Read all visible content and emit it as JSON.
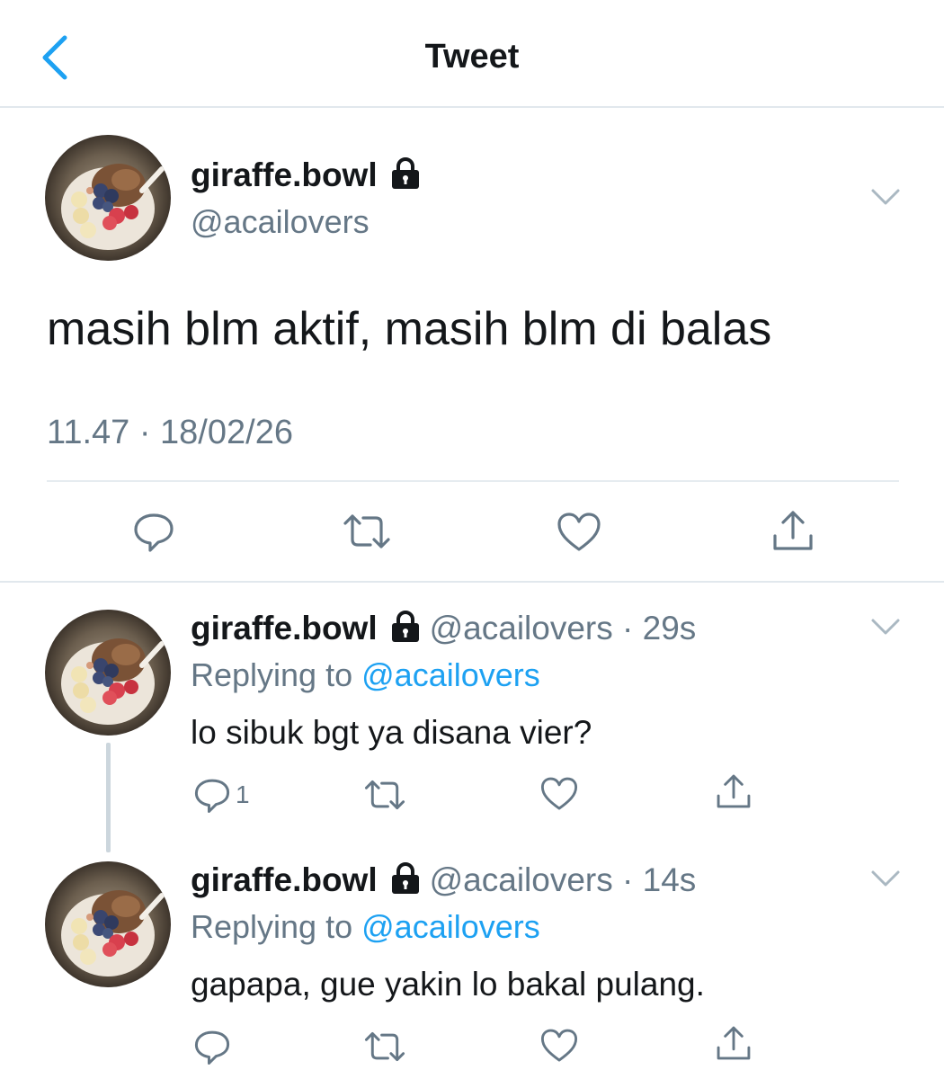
{
  "header": {
    "title": "Tweet"
  },
  "colors": {
    "accent": "#1da1f2",
    "muted": "#657786",
    "text": "#14171a",
    "border": "#e1e8ed"
  },
  "tweet": {
    "name": "giraffe.bowl",
    "handle": "@acailovers",
    "text": "masih blm aktif, masih blm di balas",
    "timestamp": "11.47 · 18/02/26",
    "actions": [
      "reply-icon",
      "retweet-icon",
      "like-icon",
      "share-icon"
    ]
  },
  "replies": [
    {
      "name": "giraffe.bowl",
      "handle_time": "@acailovers · 29s",
      "replying_prefix": "Replying to",
      "replying_to": "@acailovers",
      "text": "lo sibuk bgt ya disana vier?",
      "reply_count": "1"
    },
    {
      "name": "giraffe.bowl",
      "handle_time": "@acailovers · 14s",
      "replying_prefix": "Replying to",
      "replying_to": "@acailovers",
      "text": "gapapa, gue yakin lo bakal pulang."
    }
  ]
}
